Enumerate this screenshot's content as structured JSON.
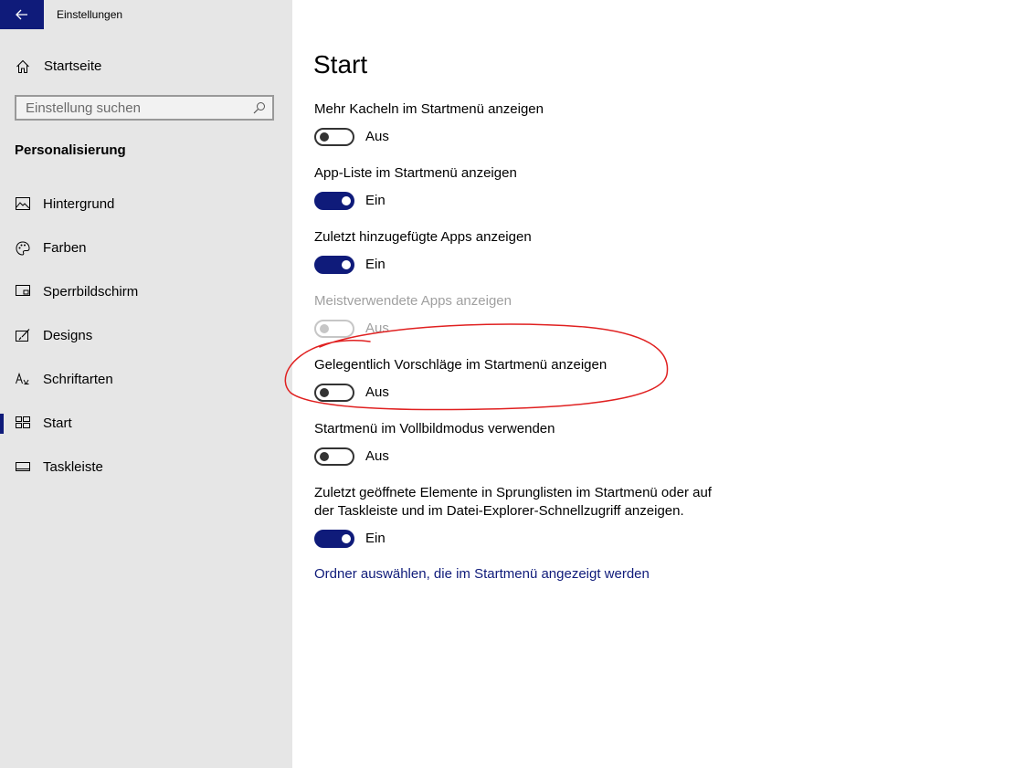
{
  "window": {
    "title": "Einstellungen"
  },
  "sidebar": {
    "home_label": "Startseite",
    "search": {
      "placeholder": "Einstellung suchen",
      "value": ""
    },
    "section_heading": "Personalisierung",
    "items": [
      {
        "label": "Hintergrund",
        "icon": "picture-icon",
        "selected": false
      },
      {
        "label": "Farben",
        "icon": "palette-icon",
        "selected": false
      },
      {
        "label": "Sperrbildschirm",
        "icon": "lock-screen-icon",
        "selected": false
      },
      {
        "label": "Designs",
        "icon": "designs-brush-icon",
        "selected": false
      },
      {
        "label": "Schriftarten",
        "icon": "fonts-icon",
        "selected": false
      },
      {
        "label": "Start",
        "icon": "start-tiles-icon",
        "selected": true
      },
      {
        "label": "Taskleiste",
        "icon": "taskbar-icon",
        "selected": false
      }
    ]
  },
  "main": {
    "title": "Start",
    "settings": [
      {
        "label": "Mehr Kacheln im Startmenü anzeigen",
        "state": "Aus",
        "on": false,
        "disabled": false
      },
      {
        "label": "App-Liste im Startmenü anzeigen",
        "state": "Ein",
        "on": true,
        "disabled": false
      },
      {
        "label": "Zuletzt hinzugefügte Apps anzeigen",
        "state": "Ein",
        "on": true,
        "disabled": false
      },
      {
        "label": "Meistverwendete Apps anzeigen",
        "state": "Aus",
        "on": false,
        "disabled": true
      },
      {
        "label": "Gelegentlich Vorschläge im Startmenü anzeigen",
        "state": "Aus",
        "on": false,
        "disabled": false
      },
      {
        "label": "Startmenü im Vollbildmodus verwenden",
        "state": "Aus",
        "on": false,
        "disabled": false
      },
      {
        "label": "Zuletzt geöffnete Elemente in Sprunglisten im Startmenü oder auf der Taskleiste und im Datei-Explorer-Schnellzugriff anzeigen.",
        "state": "Ein",
        "on": true,
        "disabled": false
      }
    ],
    "link": "Ordner auswählen, die im Startmenü angezeigt werden"
  },
  "colors": {
    "accent": "#0f1b7a",
    "sidebar_bg": "#e6e6e6",
    "annotation": "#e02020"
  }
}
